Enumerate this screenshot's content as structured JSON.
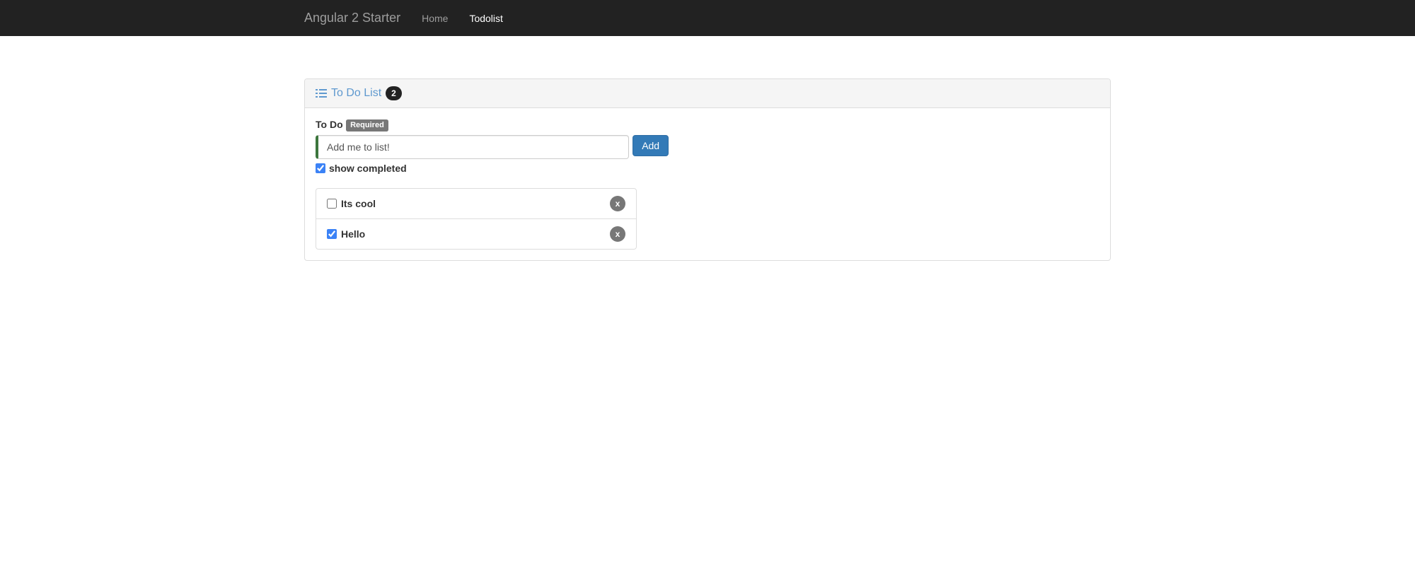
{
  "nav": {
    "brand": "Angular 2 Starter",
    "links": [
      {
        "label": "Home",
        "active": false
      },
      {
        "label": "Todolist",
        "active": true
      }
    ]
  },
  "panel": {
    "title": "To Do List",
    "count": "2"
  },
  "form": {
    "label": "To Do",
    "required_badge": "Required",
    "input_value": "Add me to list!",
    "add_button": "Add",
    "show_completed_label": "show completed",
    "show_completed_checked": true
  },
  "todos": [
    {
      "text": "Its cool",
      "completed": false,
      "delete": "x"
    },
    {
      "text": "Hello",
      "completed": true,
      "delete": "x"
    }
  ]
}
